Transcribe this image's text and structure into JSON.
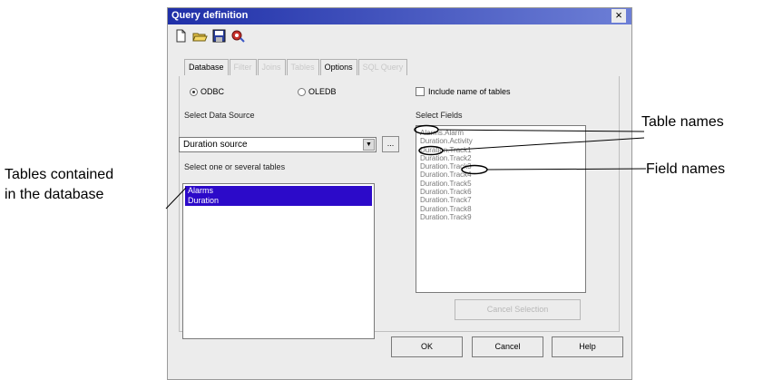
{
  "dialog": {
    "title": "Query definition",
    "close_label": "×",
    "toolbar_icons": [
      "new-icon",
      "open-icon",
      "save-icon",
      "run-query-icon"
    ]
  },
  "tabs": [
    {
      "label": "Database",
      "active": true
    },
    {
      "label": "Filter",
      "active": false
    },
    {
      "label": "Joins",
      "active": false
    },
    {
      "label": "Tables",
      "active": false
    },
    {
      "label": "Options",
      "active": true
    },
    {
      "label": "SQL Query",
      "active": false
    }
  ],
  "database_tab": {
    "radio_odbc": "ODBC",
    "radio_oledb": "OLEDB",
    "include_tables_label": "Include name of tables",
    "select_source_label": "Select Data Source",
    "data_source_value": "Duration source",
    "browse_label": "...",
    "select_tables_label": "Select one or several tables",
    "tables": [
      "Alarms",
      "Duration"
    ],
    "select_fields_label": "Select Fields",
    "fields": [
      "Alarms.Alarm",
      "Duration.Activity",
      "Duration.Track1",
      "Duration.Track2",
      "Duration.Track3",
      "Duration.Track4",
      "Duration.Track5",
      "Duration.Track6",
      "Duration.Track7",
      "Duration.Track8",
      "Duration.Track9"
    ],
    "cancel_selection_label": "Cancel Selection"
  },
  "buttons": {
    "ok": "OK",
    "cancel": "Cancel",
    "help": "Help"
  },
  "annotations": {
    "table_names": "Table names",
    "field_names": "Field names",
    "tables_contained_line1": "Tables contained",
    "tables_contained_line2": "in the database"
  }
}
